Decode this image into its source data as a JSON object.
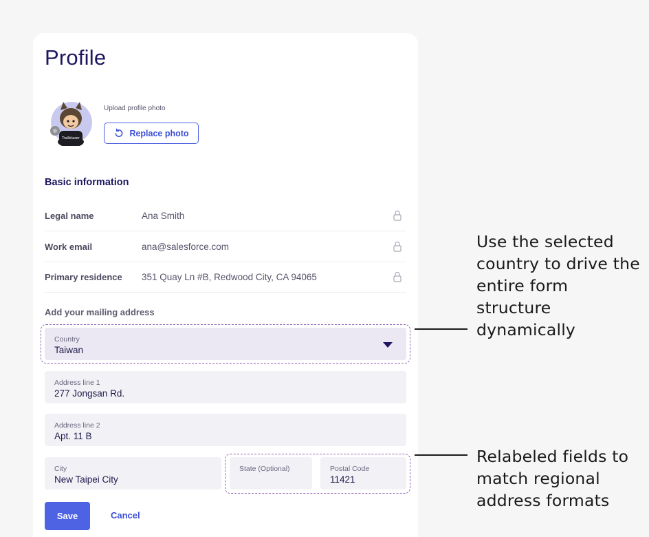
{
  "page": {
    "title": "Profile"
  },
  "photo": {
    "upload_label": "Upload profile photo",
    "replace_label": "Replace photo",
    "replace_icon": "rotate-ccw-icon"
  },
  "basic_info": {
    "title": "Basic information",
    "rows": [
      {
        "label": "Legal name",
        "value": "Ana Smith"
      },
      {
        "label": "Work email",
        "value": "ana@salesforce.com"
      },
      {
        "label": "Primary residence",
        "value": "351 Quay Ln #B, Redwood City, CA 94065"
      }
    ],
    "row_icon": "lock-icon"
  },
  "mailing": {
    "title": "Add your mailing address",
    "country": {
      "label": "Country",
      "value": "Taiwan"
    },
    "address1": {
      "label": "Address line 1",
      "value": "277 Jongsan Rd."
    },
    "address2": {
      "label": "Address line 2",
      "value": "Apt. 11 B"
    },
    "city": {
      "label": "City",
      "value": "New Taipei City"
    },
    "state": {
      "label": "State (Optional)",
      "value": ""
    },
    "postal": {
      "label": "Postal Code",
      "value": "11421"
    }
  },
  "actions": {
    "save": "Save",
    "cancel": "Cancel"
  },
  "annotations": {
    "top": [
      "Use the selected",
      "country to drive the",
      "entire form",
      "structure",
      "dynamically"
    ],
    "bottom": [
      "Relabeled fields to",
      "match regional",
      "address formats"
    ]
  },
  "colors": {
    "accent": "#4d63e4",
    "title": "#1d1660",
    "highlight_border": "#8e5fb5",
    "field_bg": "#f2f1f6"
  }
}
